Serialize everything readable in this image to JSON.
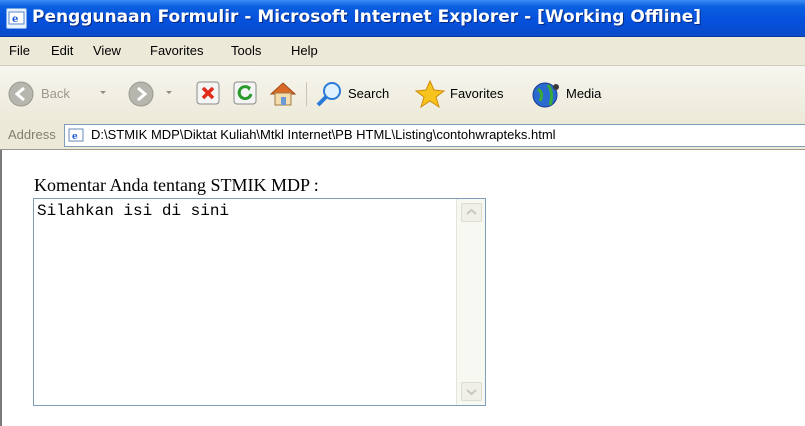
{
  "window": {
    "title": "Penggunaan Formulir - Microsoft Internet Explorer - [Working Offline]"
  },
  "menu": {
    "items": [
      "File",
      "Edit",
      "View",
      "Favorites",
      "Tools",
      "Help"
    ]
  },
  "toolbar": {
    "back_label": "Back",
    "search_label": "Search",
    "favorites_label": "Favorites",
    "media_label": "Media"
  },
  "address": {
    "label": "Address",
    "url": "D:\\STMIK MDP\\Diktat Kuliah\\Mtkl Internet\\PB HTML\\Listing\\contohwrapteks.html"
  },
  "form": {
    "label": "Komentar Anda tentang STMIK MDP :",
    "textarea_value": "Silahkan isi di sini"
  }
}
